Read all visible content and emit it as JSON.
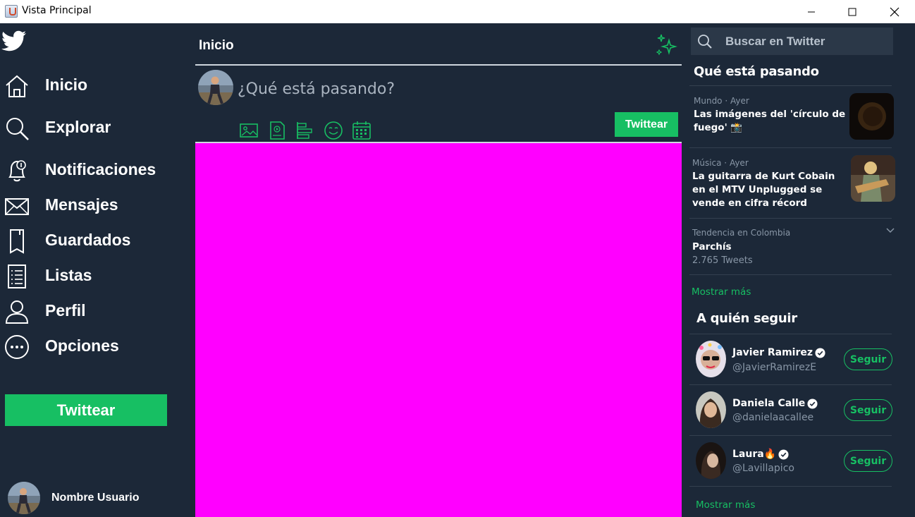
{
  "window": {
    "title": "Vista Principal",
    "controls": [
      "minimize",
      "maximize",
      "close"
    ]
  },
  "sidebar": {
    "logo": "twitter-bird-icon",
    "items": [
      {
        "label": "Inicio",
        "icon": "home-icon"
      },
      {
        "label": "Explorar",
        "icon": "search-icon"
      },
      {
        "label": "Notificaciones",
        "icon": "bell-icon"
      },
      {
        "label": "Mensajes",
        "icon": "envelope-icon"
      },
      {
        "label": "Guardados",
        "icon": "bookmark-icon"
      },
      {
        "label": "Listas",
        "icon": "list-icon"
      },
      {
        "label": "Perfil",
        "icon": "person-icon"
      },
      {
        "label": "Opciones",
        "icon": "more-icon"
      }
    ],
    "tweet_button": "Twittear",
    "user_name": "Nombre Usuario"
  },
  "main": {
    "title": "Inicio",
    "compose": {
      "placeholder": "¿Qué está pasando?",
      "tools": [
        "image-icon",
        "gif-icon",
        "poll-icon",
        "emoji-icon",
        "schedule-icon"
      ],
      "tweet_button": "Twittear"
    }
  },
  "right": {
    "search_placeholder": "Buscar en Twitter",
    "trends_heading": "Qué está pasando",
    "trends": [
      {
        "meta": "Mundo · Ayer",
        "title": "Las imágenes del 'círculo de fuego' 📸"
      },
      {
        "meta": "Música · Ayer",
        "title": "La guitarra de Kurt Cobain en el MTV Unplugged se vende en cifra récord"
      },
      {
        "meta": "Tendencia en Colombia",
        "title": "Parchís",
        "count": "2.765 Tweets"
      }
    ],
    "show_more_trends": "Mostrar más",
    "follow_heading": "A quién seguir",
    "follow": [
      {
        "name": "Javier Ramirez",
        "handle": "@JavierRamirezE",
        "button": "Seguir"
      },
      {
        "name": "Daniela Calle",
        "handle": "@danielaacallee",
        "button": "Seguir"
      },
      {
        "name": "Laura🔥",
        "handle": "@Lavillapico",
        "button": "Seguir"
      }
    ],
    "show_more_follow": "Mostrar más"
  },
  "colors": {
    "accent": "#17bf63",
    "background": "#1c2838",
    "feed_placeholder": "#ff00ff",
    "search_bg": "#2b3848"
  }
}
